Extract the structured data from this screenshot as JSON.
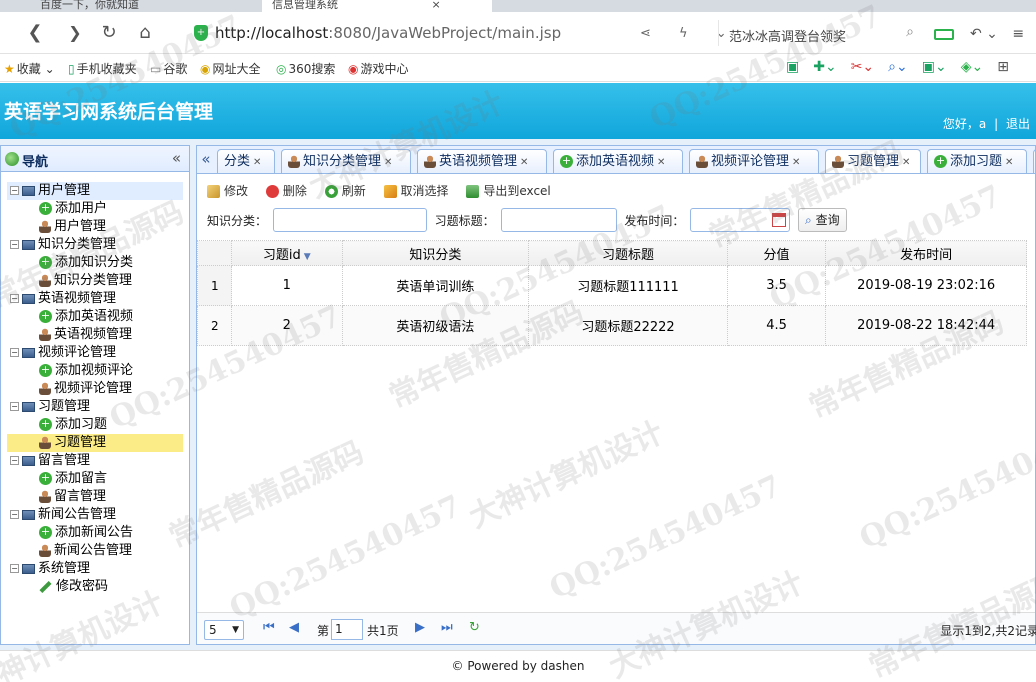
{
  "browser": {
    "tabs": [
      {
        "label": "百度一下，你就知道"
      },
      {
        "label": "信息管理系统",
        "active": true
      }
    ],
    "url_host": "http://localhost",
    "url_rest": ":8080/JavaWebProject/main.jsp",
    "search_text": "范冰冰高调登台领奖",
    "bookmarks": [
      "收藏",
      "手机收藏夹",
      "谷歌",
      "网址大全",
      "360搜索",
      "游戏中心"
    ]
  },
  "app": {
    "title": "英语学习网系统后台管理",
    "greeting": "您好，a",
    "separator": "|",
    "logout": "退出"
  },
  "nav": {
    "title": "导航",
    "groups": [
      {
        "label": "用户管理",
        "children": [
          {
            "label": "添加用户",
            "icon": "plus"
          },
          {
            "label": "用户管理",
            "icon": "user"
          }
        ]
      },
      {
        "label": "知识分类管理",
        "children": [
          {
            "label": "添加知识分类",
            "icon": "plus"
          },
          {
            "label": "知识分类管理",
            "icon": "user"
          }
        ]
      },
      {
        "label": "英语视频管理",
        "children": [
          {
            "label": "添加英语视频",
            "icon": "plus"
          },
          {
            "label": "英语视频管理",
            "icon": "user"
          }
        ]
      },
      {
        "label": "视频评论管理",
        "children": [
          {
            "label": "添加视频评论",
            "icon": "plus"
          },
          {
            "label": "视频评论管理",
            "icon": "user"
          }
        ]
      },
      {
        "label": "习题管理",
        "children": [
          {
            "label": "添加习题",
            "icon": "plus"
          },
          {
            "label": "习题管理",
            "icon": "user",
            "selected": true
          }
        ]
      },
      {
        "label": "留言管理",
        "children": [
          {
            "label": "添加留言",
            "icon": "plus"
          },
          {
            "label": "留言管理",
            "icon": "user"
          }
        ]
      },
      {
        "label": "新闻公告管理",
        "children": [
          {
            "label": "添加新闻公告",
            "icon": "plus"
          },
          {
            "label": "新闻公告管理",
            "icon": "user"
          }
        ]
      },
      {
        "label": "系统管理",
        "children": [
          {
            "label": "修改密码",
            "icon": "pencil"
          }
        ]
      }
    ]
  },
  "tabs": [
    {
      "label": "分类",
      "icon": "none"
    },
    {
      "label": "知识分类管理",
      "icon": "user"
    },
    {
      "label": "英语视频管理",
      "icon": "user"
    },
    {
      "label": "添加英语视频",
      "icon": "plus"
    },
    {
      "label": "视频评论管理",
      "icon": "user"
    },
    {
      "label": "习题管理",
      "icon": "user",
      "selected": true
    },
    {
      "label": "添加习题",
      "icon": "plus"
    },
    {
      "label": "",
      "icon": "none"
    }
  ],
  "toolbar": {
    "edit": "修改",
    "delete": "删除",
    "refresh": "刷新",
    "cancel_select": "取消选择",
    "export": "导出到excel"
  },
  "search": {
    "category_label": "知识分类：",
    "title_label": "习题标题：",
    "time_label": "发布时间：",
    "query_button": "查询"
  },
  "table": {
    "columns": [
      "习题id",
      "知识分类",
      "习题标题",
      "分值",
      "发布时间"
    ],
    "rows": [
      {
        "num": "1",
        "id": "1",
        "category": "英语单词训练",
        "title": "习题标题111111",
        "score": "3.5",
        "time": "2019-08-19 23:02:16"
      },
      {
        "num": "2",
        "id": "2",
        "category": "英语初级语法",
        "title": "习题标题22222",
        "score": "4.5",
        "time": "2019-08-22 18:42:44"
      }
    ]
  },
  "pager": {
    "page_size": "5",
    "page_label": "第",
    "page_value": "1",
    "total_pages": "共1页",
    "info": "显示1到2,共2记录"
  },
  "footer": {
    "text": "© Powered by dashen"
  },
  "watermarks": [
    "QQ:254540457",
    "大神计算机设计",
    "常年售精品源码"
  ]
}
